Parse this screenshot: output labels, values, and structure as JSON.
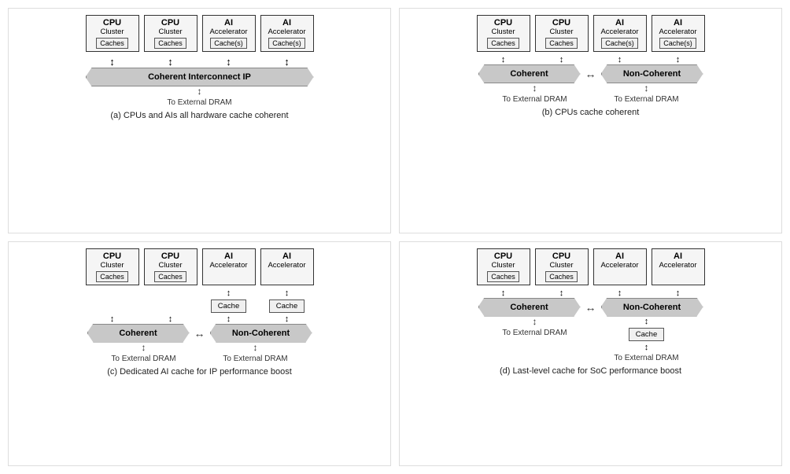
{
  "diagrams": [
    {
      "id": "a",
      "caption": "(a) CPUs and AIs all hardware cache coherent",
      "units": [
        {
          "title": "CPU",
          "sub": "Cluster",
          "cache": "Caches"
        },
        {
          "title": "CPU",
          "sub": "Cluster",
          "cache": "Caches"
        },
        {
          "title": "AI",
          "sub": "Accelerator",
          "cache": "Cache(s)"
        },
        {
          "title": "AI",
          "sub": "Accelerator",
          "cache": "Cache(s)"
        }
      ],
      "interconnect": "Coherent Interconnect IP",
      "type": "single-banner",
      "dram": [
        "To External DRAM"
      ]
    },
    {
      "id": "b",
      "caption": "(b) CPUs cache coherent",
      "units": [
        {
          "title": "CPU",
          "sub": "Cluster",
          "cache": "Caches"
        },
        {
          "title": "CPU",
          "sub": "Cluster",
          "cache": "Caches"
        },
        {
          "title": "AI",
          "sub": "Accelerator",
          "cache": "Cache(s)"
        },
        {
          "title": "AI",
          "sub": "Accelerator",
          "cache": "Cache(s)"
        }
      ],
      "interconnect_left": "Coherent",
      "interconnect_right": "Non-Coherent",
      "type": "dual-banner",
      "dram": [
        "To External DRAM",
        "To External DRAM"
      ]
    },
    {
      "id": "c",
      "caption": "(c) Dedicated AI cache for IP performance boost",
      "units": [
        {
          "title": "CPU",
          "sub": "Cluster",
          "cache": "Caches"
        },
        {
          "title": "CPU",
          "sub": "Cluster",
          "cache": "Caches"
        },
        {
          "title": "AI",
          "sub": "Accelerator",
          "cache": ""
        },
        {
          "title": "AI",
          "sub": "Accelerator",
          "cache": ""
        }
      ],
      "interconnect_left": "Coherent",
      "interconnect_right": "Non-Coherent",
      "type": "dual-banner-cache",
      "mid_cache": "Cache",
      "dram": [
        "To External DRAM",
        "To External DRAM"
      ]
    },
    {
      "id": "d",
      "caption": "(d) Last-level cache for SoC performance boost",
      "units": [
        {
          "title": "CPU",
          "sub": "Cluster",
          "cache": "Caches"
        },
        {
          "title": "CPU",
          "sub": "Cluster",
          "cache": "Caches"
        },
        {
          "title": "AI",
          "sub": "Accelerator",
          "cache": ""
        },
        {
          "title": "AI",
          "sub": "Accelerator",
          "cache": ""
        }
      ],
      "interconnect_left": "Coherent",
      "interconnect_right": "Non-Coherent",
      "type": "dual-banner-cache-bottom",
      "mid_cache": "Cache",
      "dram": [
        "To External DRAM",
        "To External DRAM"
      ]
    }
  ]
}
